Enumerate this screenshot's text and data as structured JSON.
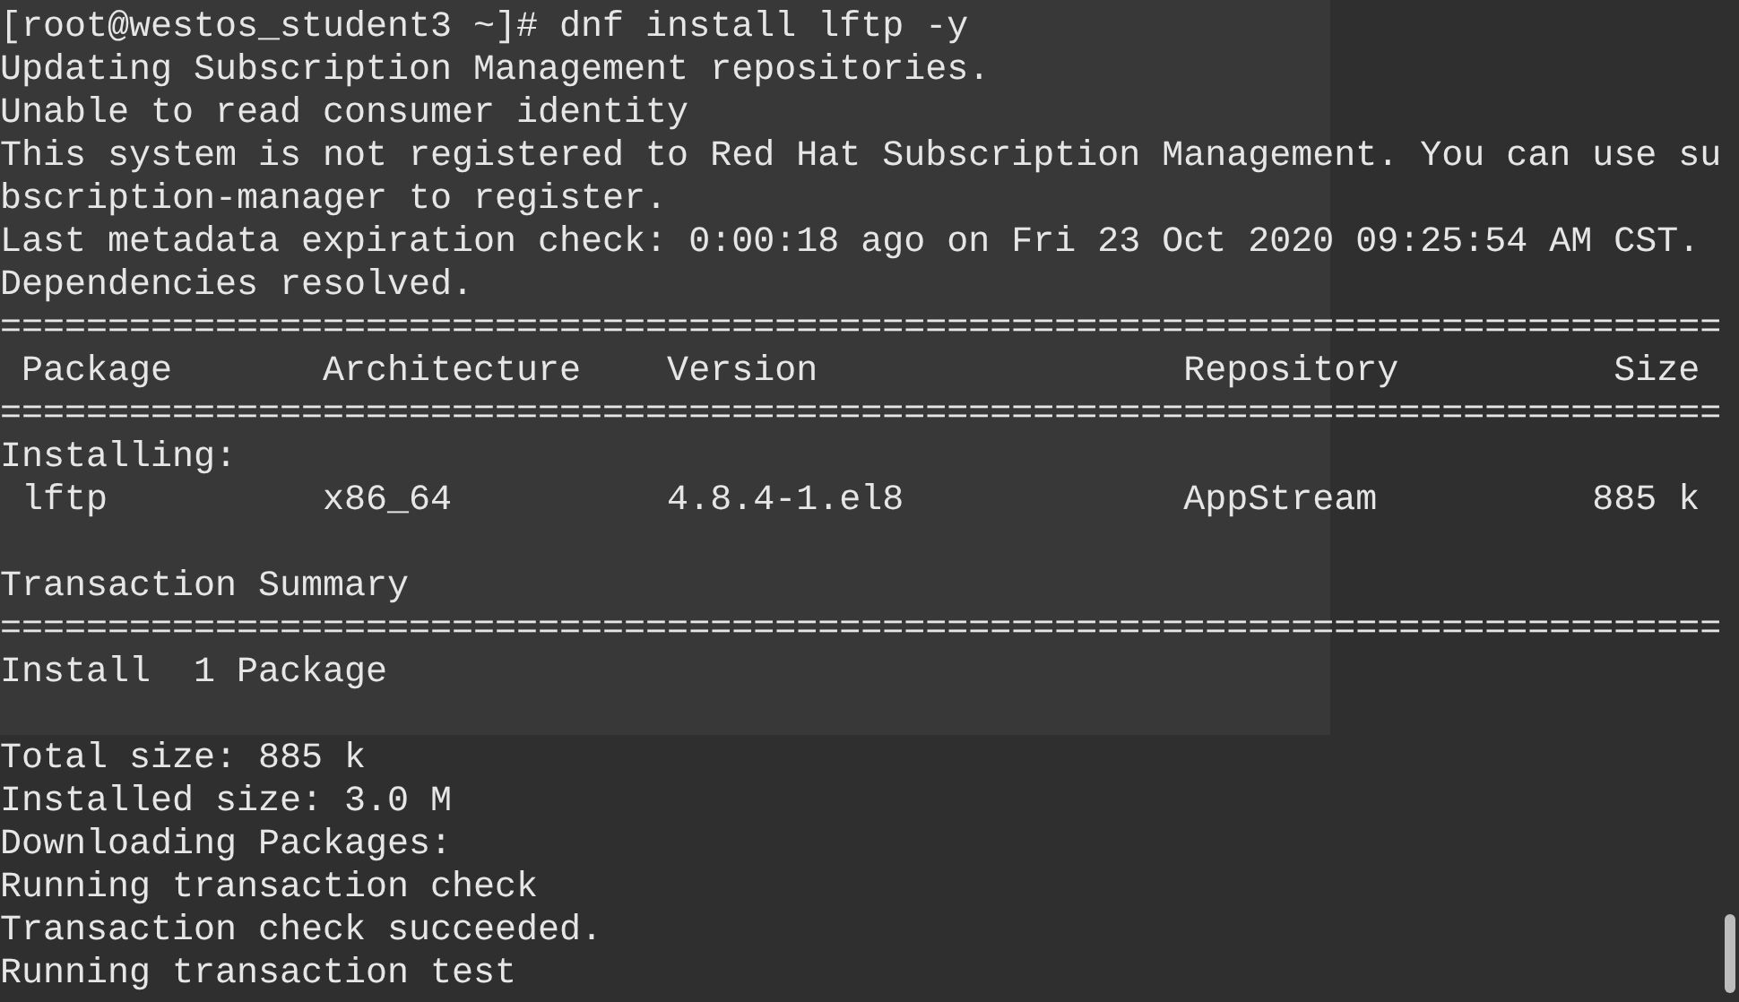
{
  "terminal": {
    "lines": [
      {
        "text": "[root@westos_student3 ~]# dnf install lftp -y"
      },
      {
        "text": "Updating Subscription Management repositories."
      },
      {
        "text": "Unable to read consumer identity"
      },
      {
        "text": "This system is not registered to Red Hat Subscription Management. You can use su"
      },
      {
        "text": "bscription-manager to register."
      },
      {
        "text": "Last metadata expiration check: 0:00:18 ago on Fri 23 Oct 2020 09:25:54 AM CST."
      },
      {
        "text": "Dependencies resolved."
      },
      {
        "text": "================================================================================"
      },
      {
        "text": " Package       Architecture    Version                 Repository          Size"
      },
      {
        "text": "================================================================================"
      },
      {
        "text": "Installing:"
      },
      {
        "text": " lftp          x86_64          4.8.4-1.el8             AppStream          885 k"
      },
      {
        "text": "Transaction Summary",
        "gap_before": true
      },
      {
        "text": "================================================================================"
      },
      {
        "text": "Install  1 Package"
      },
      {
        "text": "Total size: 885 k",
        "gap_before": true
      },
      {
        "text": "Installed size: 3.0 M"
      },
      {
        "text": "Downloading Packages:"
      },
      {
        "text": "Running transaction check"
      },
      {
        "text": "Transaction check succeeded."
      },
      {
        "text": "Running transaction test"
      }
    ]
  }
}
